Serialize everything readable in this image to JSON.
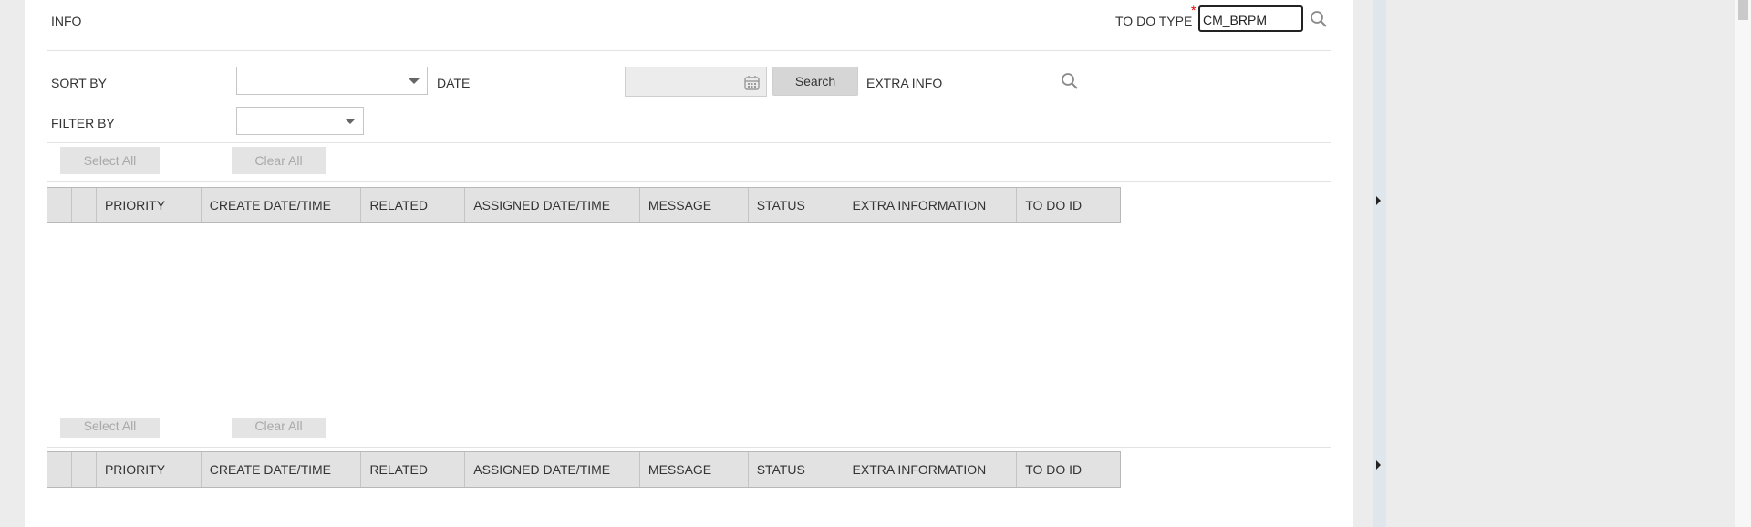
{
  "header": {
    "info_label": "INFO",
    "todo_type_label": "TO DO TYPE",
    "todo_type_required": "*",
    "todo_type_value": "CM_BRPM"
  },
  "filters": {
    "sort_by_label": "SORT BY",
    "sort_by_value": "",
    "date_label": "DATE",
    "date_value": "",
    "search_button": "Search",
    "extra_info_label": "EXTRA INFO",
    "filter_by_label": "FILTER BY",
    "filter_by_value": ""
  },
  "actions": {
    "select_all": "Select All",
    "clear_all": "Clear All"
  },
  "grid": {
    "columns": [
      "PRIORITY",
      "CREATE DATE/TIME",
      "RELATED",
      "ASSIGNED DATE/TIME",
      "MESSAGE",
      "STATUS",
      "EXTRA INFORMATION",
      "TO DO ID"
    ]
  },
  "icons": {
    "search": "search-icon",
    "calendar": "calendar-icon",
    "dropdown": "chevron-down-icon",
    "expand": "caret-right-icon"
  }
}
